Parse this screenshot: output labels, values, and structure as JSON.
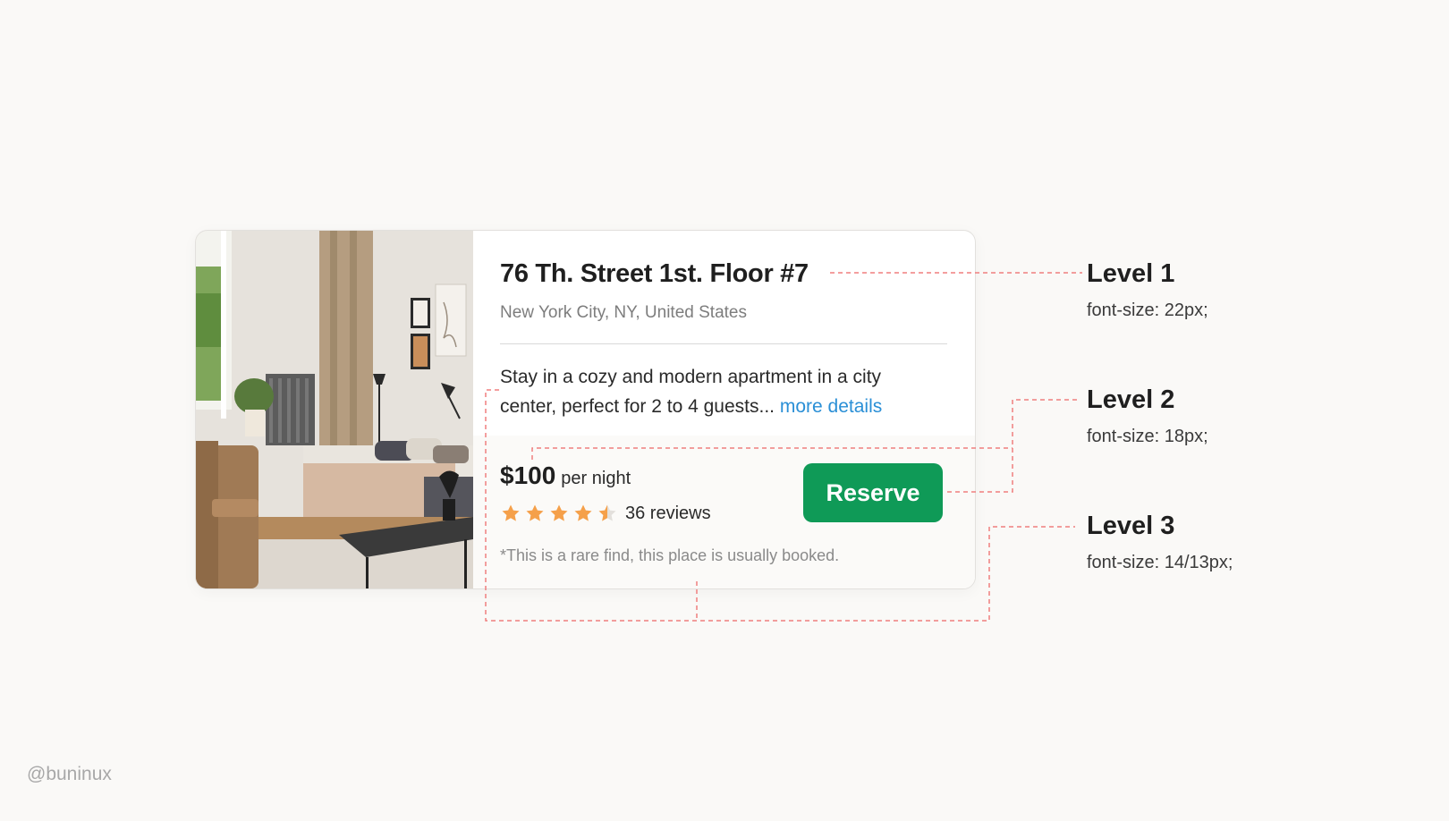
{
  "card": {
    "image_alt": "Apartment bedroom photo",
    "title": "76 Th. Street 1st. Floor #7",
    "location": "New York City, NY, United States",
    "description": "Stay in a cozy and modern apartment in a city center, perfect for 2 to 4 guests...",
    "more_link": "more details",
    "price": "$100",
    "price_unit": "per night",
    "rating": 4.5,
    "rating_max": 5,
    "reviews": "36 reviews",
    "reserve_label": "Reserve",
    "note": "*This is a rare find, this place is usually booked."
  },
  "levels": [
    {
      "title": "Level 1",
      "desc": "font-size: 22px;"
    },
    {
      "title": "Level 2",
      "desc": "font-size: 18px;"
    },
    {
      "title": "Level 3",
      "desc": "font-size: 14/13px;"
    }
  ],
  "watermark": "@buninux",
  "colors": {
    "accent_green": "#0f9a57",
    "link_blue": "#2a8fd6",
    "star_orange": "#f5a04a",
    "guide_red": "#f07f7f",
    "background": "#faf9f7"
  },
  "icons": {
    "star": "star-icon",
    "half_star": "star-half-icon"
  }
}
